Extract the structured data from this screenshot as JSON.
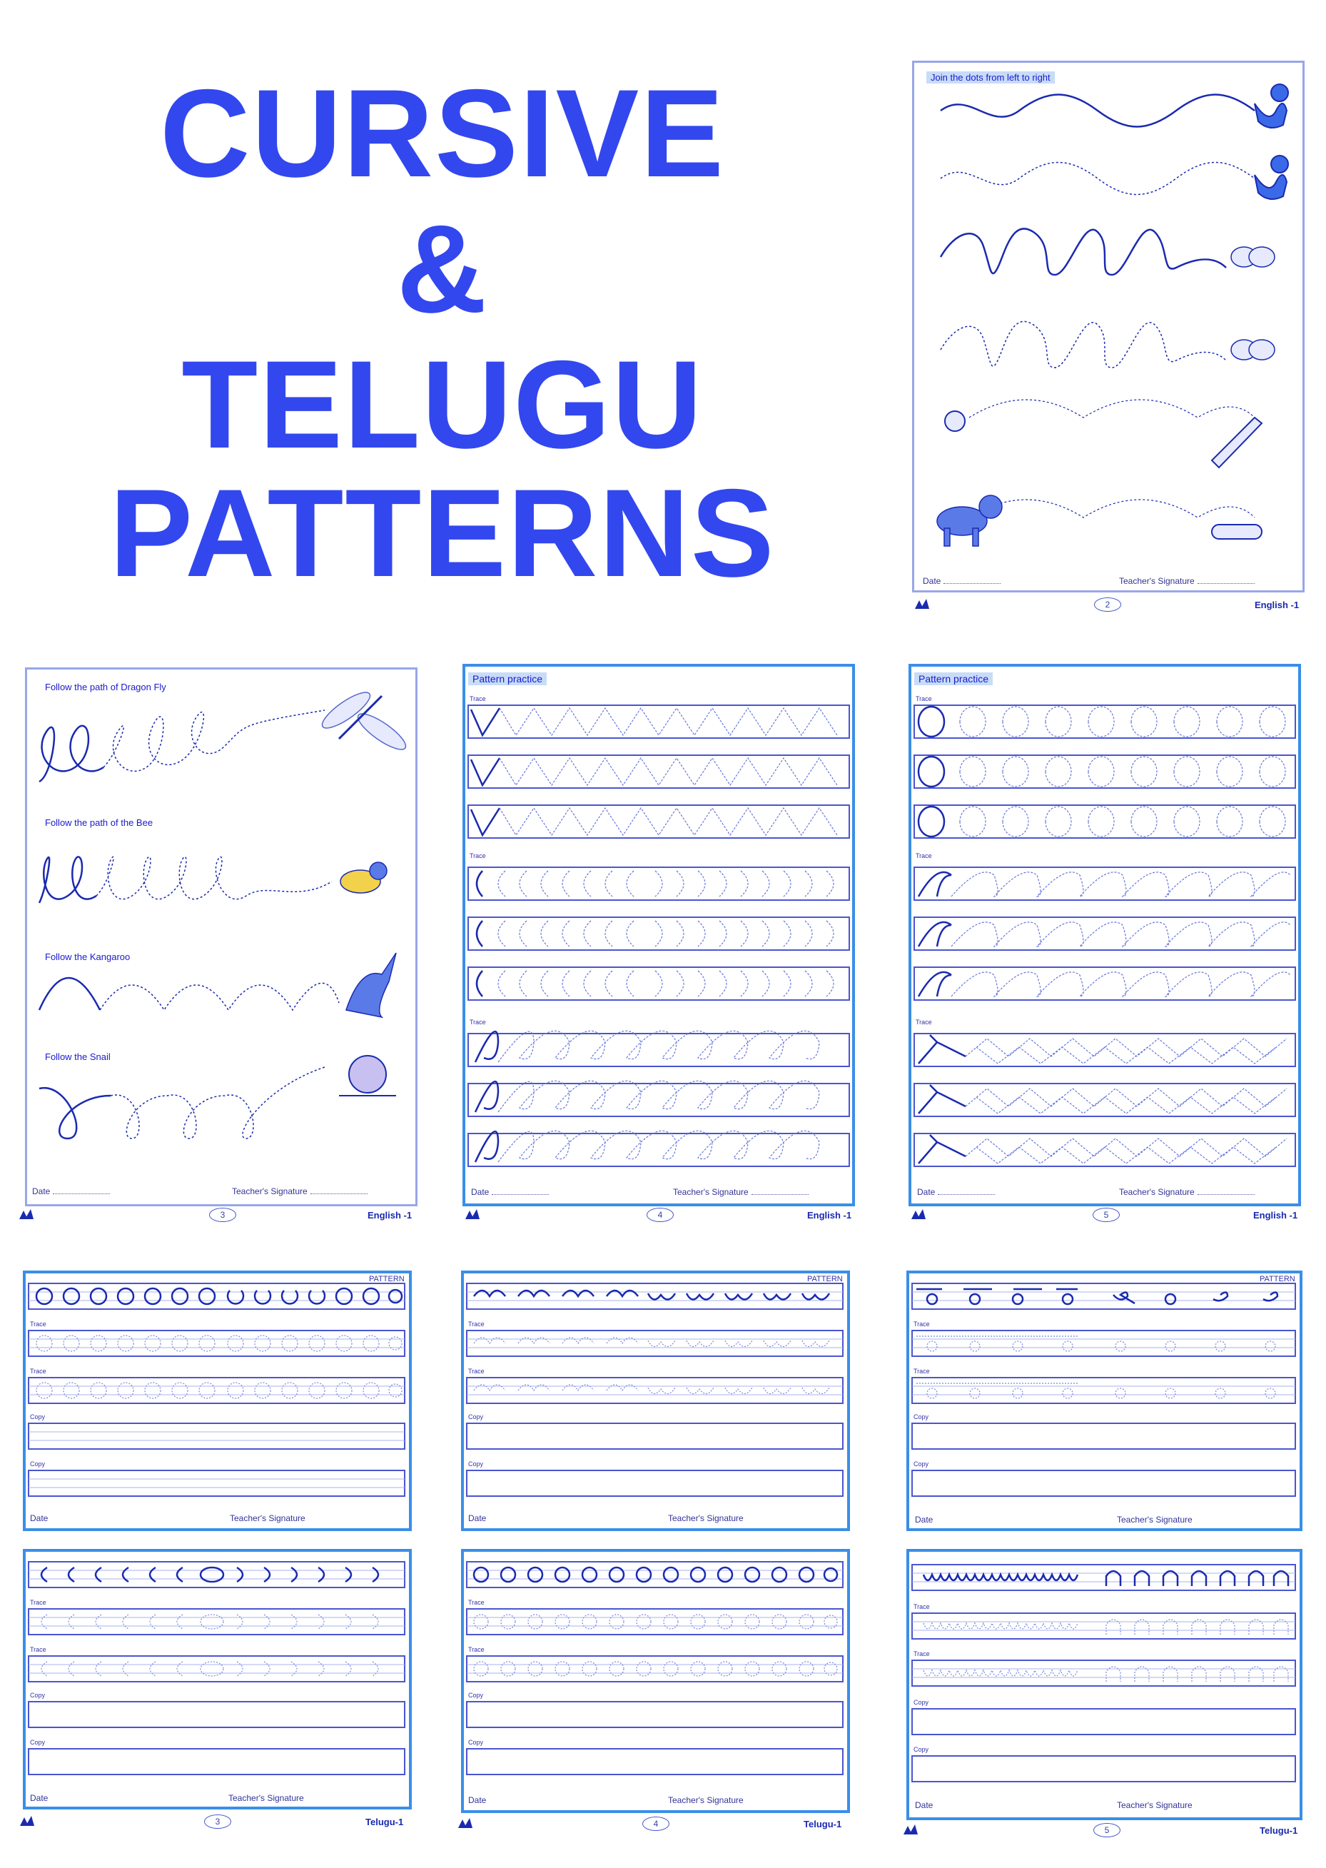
{
  "title": {
    "line1": "CURSIVE",
    "line2": "&",
    "line3": "TELUGU",
    "line4": "PATTERNS"
  },
  "common": {
    "date": "Date",
    "signature": "Teacher's Signature",
    "trace": "Trace",
    "copy": "Copy",
    "book_english": "English -1",
    "book_telugu": "Telugu-1",
    "pattern": "PATTERN"
  },
  "sheet2": {
    "header": "Join the dots from left to right",
    "page": "2"
  },
  "sheet3": {
    "page": "3",
    "labels": [
      "Follow the path of Dragon Fly",
      "Follow the path of the Bee",
      "Follow the Kangaroo",
      "Follow the Snail"
    ]
  },
  "sheet4": {
    "header": "Pattern practice",
    "page": "4"
  },
  "sheet5": {
    "header": "Pattern practice",
    "page": "5"
  },
  "telugu": {
    "pages": [
      "3",
      "4",
      "5"
    ]
  },
  "colors": {
    "title": "#3347ee",
    "ink": "#1a2ab0",
    "frame": "#3a8ee8",
    "frame_light": "#99a6e8"
  }
}
